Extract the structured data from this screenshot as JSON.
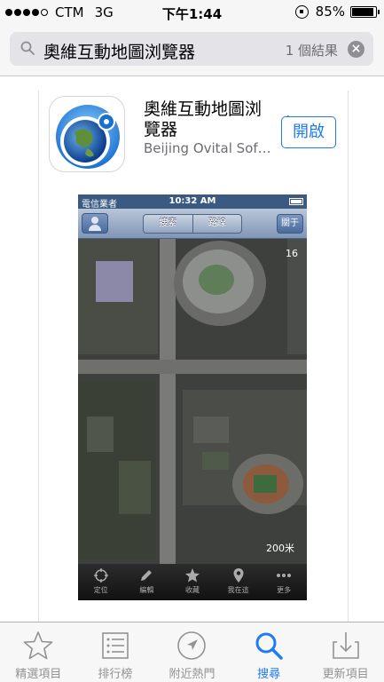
{
  "status_bar": {
    "carrier": "CTM",
    "network": "3G",
    "time": "下午1:44",
    "battery_percent": "85%",
    "battery_level": 0.85
  },
  "search": {
    "query": "奧維互動地圖浏覽器",
    "result_count": "1 個結果"
  },
  "app": {
    "name": "奧維互動地圖浏覽器",
    "developer": "Beijing Ovital Sof…",
    "open_label": "開啟",
    "plus": "+"
  },
  "preview": {
    "carrier": "電信業者",
    "time": "10:32 AM",
    "segments": [
      "搜索",
      "路線"
    ],
    "about_label": "關于",
    "zoom": "16",
    "scale": "200米",
    "tabs": [
      {
        "label": "定位",
        "icon": "crosshair-icon"
      },
      {
        "label": "編輯",
        "icon": "pencil-icon"
      },
      {
        "label": "收藏",
        "icon": "star-icon"
      },
      {
        "label": "我在這",
        "icon": "pin-icon"
      },
      {
        "label": "更多",
        "icon": "more-icon"
      }
    ]
  },
  "tab_bar": {
    "items": [
      {
        "label": "精選項目",
        "icon": "star-icon",
        "active": false
      },
      {
        "label": "排行榜",
        "icon": "list-icon",
        "active": false
      },
      {
        "label": "附近熱門",
        "icon": "location-arrow-icon",
        "active": false
      },
      {
        "label": "搜尋",
        "icon": "search-icon",
        "active": true
      },
      {
        "label": "更新項目",
        "icon": "download-icon",
        "active": false
      }
    ]
  },
  "colors": {
    "accent": "#1f7bf0",
    "inactive": "#929292"
  }
}
